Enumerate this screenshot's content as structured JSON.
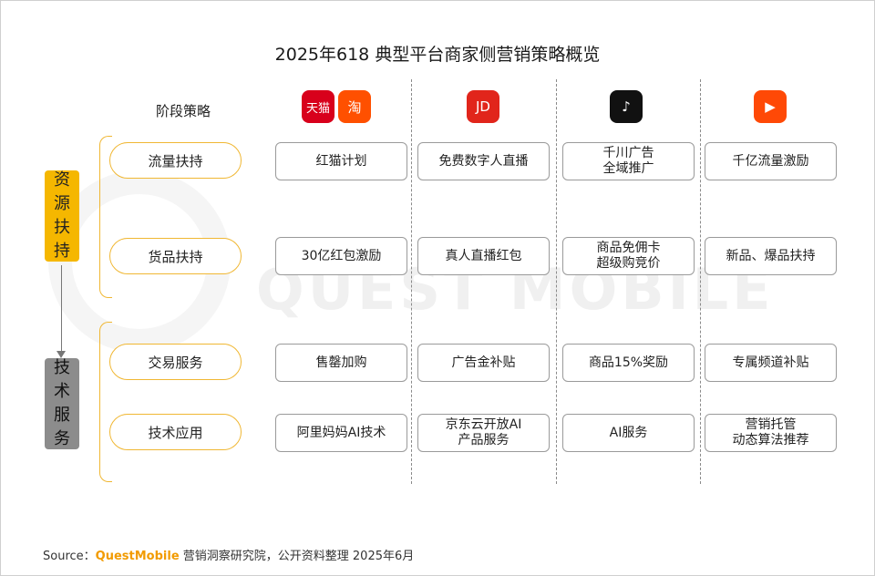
{
  "title": "2025年618 典型平台商家侧营销策略概览",
  "stage_header": "阶段策略",
  "watermark": "QUEST MOBILE",
  "platform_logos": [
    {
      "icon": "tmall-icon",
      "text": "天猫",
      "color": "#d8001b"
    },
    {
      "icon": "taobao-icon",
      "text": "淘",
      "color": "#ff5000"
    },
    {
      "icon": "jd-icon",
      "text": "JD",
      "color": "#e1251b"
    },
    {
      "icon": "douyin-icon",
      "text": "♪",
      "color": "#111111"
    },
    {
      "icon": "kuaishou-icon",
      "text": "▶",
      "color": "#ff4906"
    }
  ],
  "groups": [
    {
      "label": [
        "资",
        "源",
        "扶",
        "持"
      ],
      "color": "#f5b700"
    },
    {
      "label": [
        "技",
        "术",
        "服",
        "务"
      ],
      "color": "#999999"
    }
  ],
  "strategies": [
    "流量扶持",
    "货品扶持",
    "交易服务",
    "技术应用"
  ],
  "cells": [
    [
      [
        "红猫计划"
      ],
      [
        "免费数字人直播"
      ],
      [
        "千川广告",
        "全域推广"
      ],
      [
        "千亿流量激励"
      ]
    ],
    [
      [
        "30亿红包激励"
      ],
      [
        "真人直播红包"
      ],
      [
        "商品免佣卡",
        "超级购竞价"
      ],
      [
        "新品、爆品扶持"
      ]
    ],
    [
      [
        "售罄加购"
      ],
      [
        "广告金补贴"
      ],
      [
        "商品15%奖励"
      ],
      [
        "专属频道补贴"
      ]
    ],
    [
      [
        "阿里妈妈AI技术"
      ],
      [
        "京东云开放AI",
        "产品服务"
      ],
      [
        "AI服务"
      ],
      [
        "营销托管",
        "动态算法推荐"
      ]
    ]
  ],
  "source": {
    "label": "Source：",
    "brand": "QuestMobile",
    "text": " 营销洞察研究院，公开资料整理 2025年6月"
  }
}
